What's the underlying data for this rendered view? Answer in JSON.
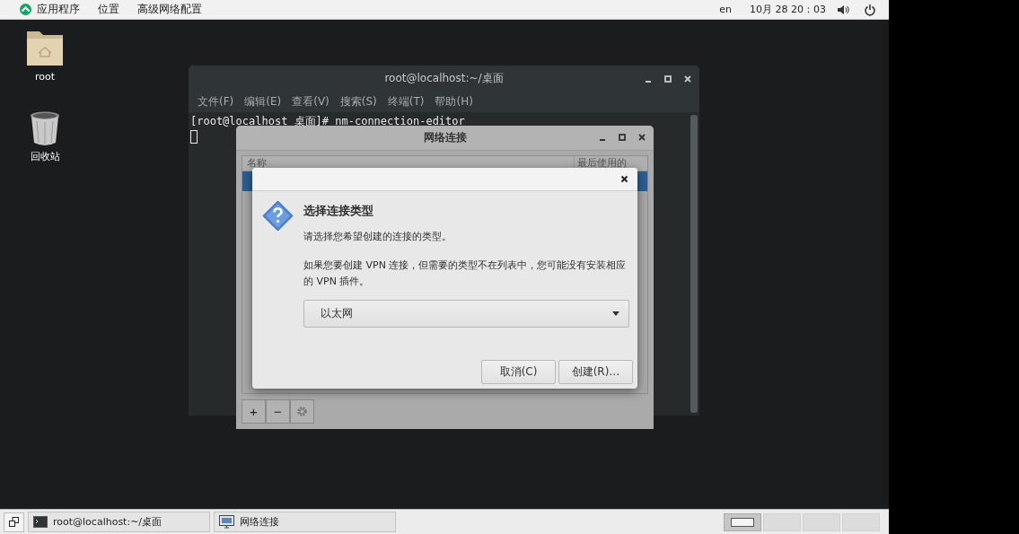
{
  "top_bar": {
    "menus": [
      "应用程序",
      "位置",
      "高级网络配置"
    ],
    "keyboard": "en",
    "clock": "10月 28 20：03"
  },
  "desktop_icons": [
    {
      "kind": "folder",
      "label": "root"
    },
    {
      "kind": "trash",
      "label": "回收站"
    }
  ],
  "terminal": {
    "title": "root@localhost:~/桌面",
    "menu": [
      "文件(F)",
      "编辑(E)",
      "查看(V)",
      "搜索(S)",
      "终端(T)",
      "帮助(H)"
    ],
    "prompt": "[root@localhost 桌面]# nm-connection-editor"
  },
  "network_window": {
    "title": "网络连接",
    "columns": [
      "名称",
      "最后使用的"
    ],
    "toolbar": [
      "+",
      "−"
    ]
  },
  "dialog": {
    "title": "选择连接类型",
    "message": "请选择您希望创建的连接的类型。",
    "note": "如果您要创建 VPN 连接，但需要的类型不在列表中，您可能没有安装相应的 VPN 插件。",
    "connection_type": "以太网",
    "buttons": [
      "取消(C)",
      "创建(R)…"
    ]
  },
  "taskbar": {
    "tasks": [
      {
        "kind": "terminal",
        "title": "root@localhost:~/桌面",
        "selected": false
      },
      {
        "kind": "network",
        "title": "网络连接",
        "selected": false
      }
    ],
    "workspaces": [
      {
        "selected": true
      },
      {
        "selected": false
      },
      {
        "selected": false
      },
      {
        "selected": false
      }
    ]
  }
}
